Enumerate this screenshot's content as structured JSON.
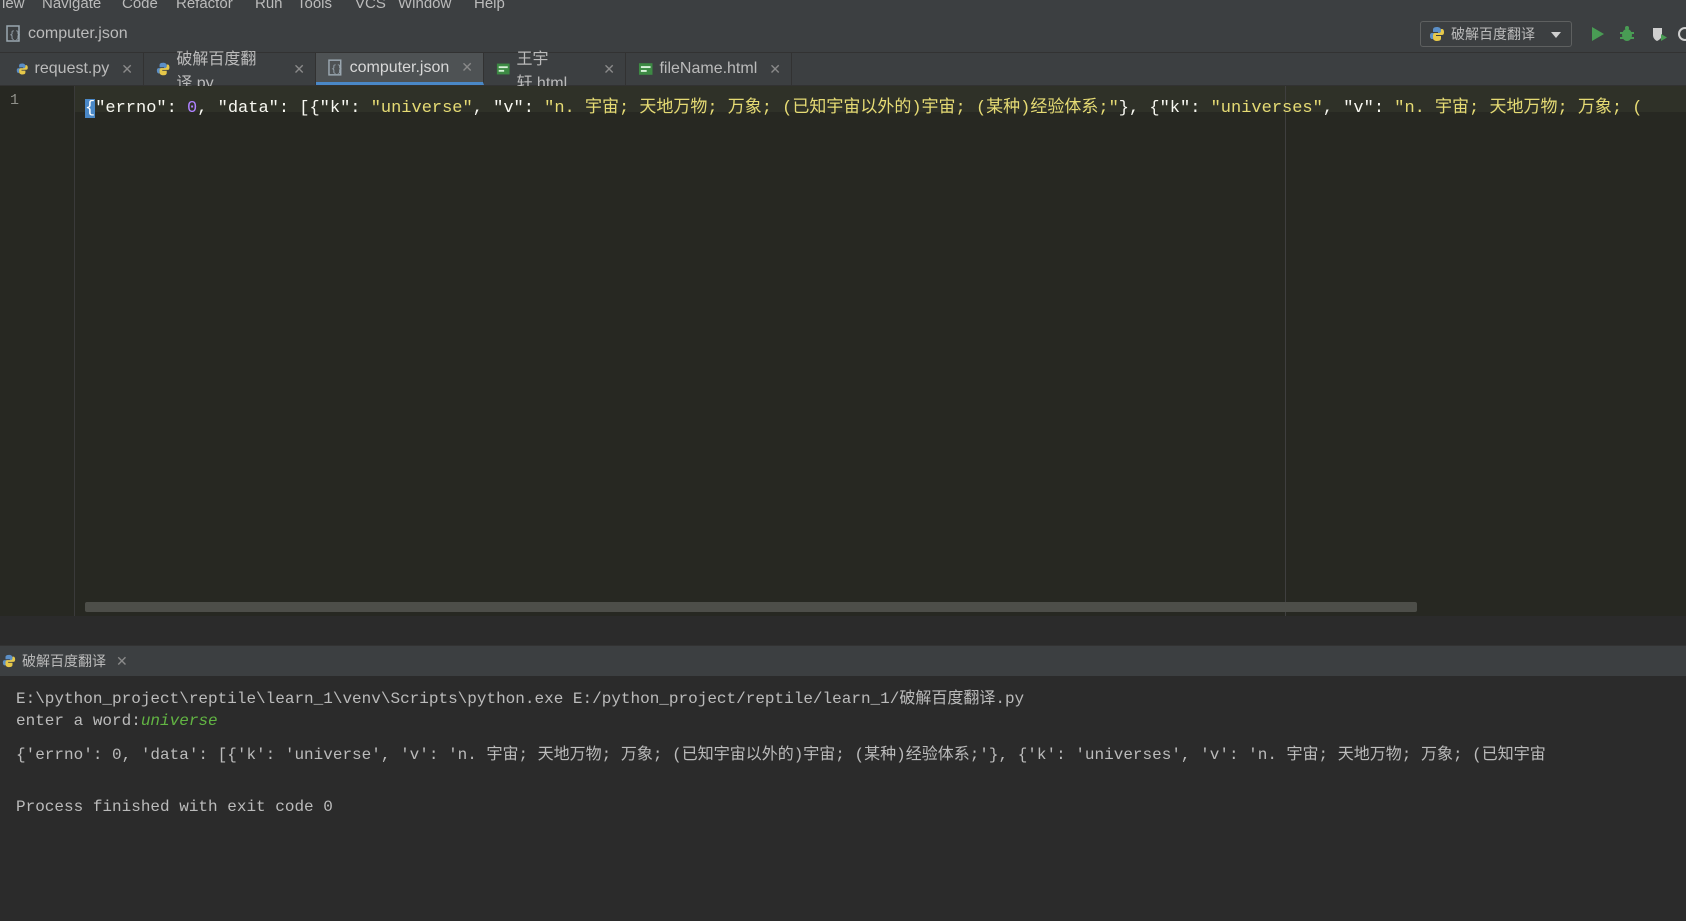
{
  "menu": [
    "iew",
    "Navigate",
    "Code",
    "Refactor",
    "Run",
    "Tools",
    "VCS",
    "Window",
    "Help"
  ],
  "breadcrumb": {
    "file": "computer.json"
  },
  "run_config": {
    "name": "破解百度翻译"
  },
  "tabs": [
    {
      "label": "request.py",
      "icon": "python-file-icon",
      "active": false
    },
    {
      "label": "破解百度翻译.py",
      "icon": "python-file-icon",
      "active": false
    },
    {
      "label": "computer.json",
      "icon": "json-file-icon",
      "active": true
    },
    {
      "label": "王宇轩.html",
      "icon": "html-file-icon",
      "active": false
    },
    {
      "label": "fileName.html",
      "icon": "html-file-icon",
      "active": false
    }
  ],
  "editor": {
    "line_number": "1",
    "code": {
      "p1": "\"errno\"",
      "p2": ": ",
      "p3": "0",
      "p4": ", ",
      "p5": "\"data\"",
      "p6": ": [{",
      "p7": "\"k\"",
      "p8": ": ",
      "p9": "\"universe\"",
      "p10": ", ",
      "p11": "\"v\"",
      "p12": ": ",
      "p13": "\"n. 宇宙; 天地万物; 万象; (已知宇宙以外的)宇宙; (某种)经验体系;\"",
      "p14": "}, {",
      "p15": "\"k\"",
      "p16": ": ",
      "p17": "\"universes\"",
      "p18": ", ",
      "p19": "\"v\"",
      "p20": ": ",
      "p21": "\"n. 宇宙; 天地万物; 万象; (",
      "open_brace": "{"
    }
  },
  "run_panel": {
    "tab_label": "破解百度翻译"
  },
  "console": {
    "line1": "E:\\python_project\\reptile\\learn_1\\venv\\Scripts\\python.exe E:/python_project/reptile/learn_1/破解百度翻译.py",
    "line2_prompt": "enter a word:",
    "line2_input": "universe",
    "line3": "{'errno': 0, 'data': [{'k': 'universe', 'v': 'n. 宇宙; 天地万物; 万象; (已知宇宙以外的)宇宙; (某种)经验体系;'}, {'k': 'universes', 'v': 'n. 宇宙; 天地万物; 万象; (已知宇宙",
    "line4": "Process finished with exit code 0"
  },
  "colors": {
    "accent": "#4a88c7",
    "string": "#e6db74",
    "number": "#ae81ff",
    "input": "#62b543"
  }
}
